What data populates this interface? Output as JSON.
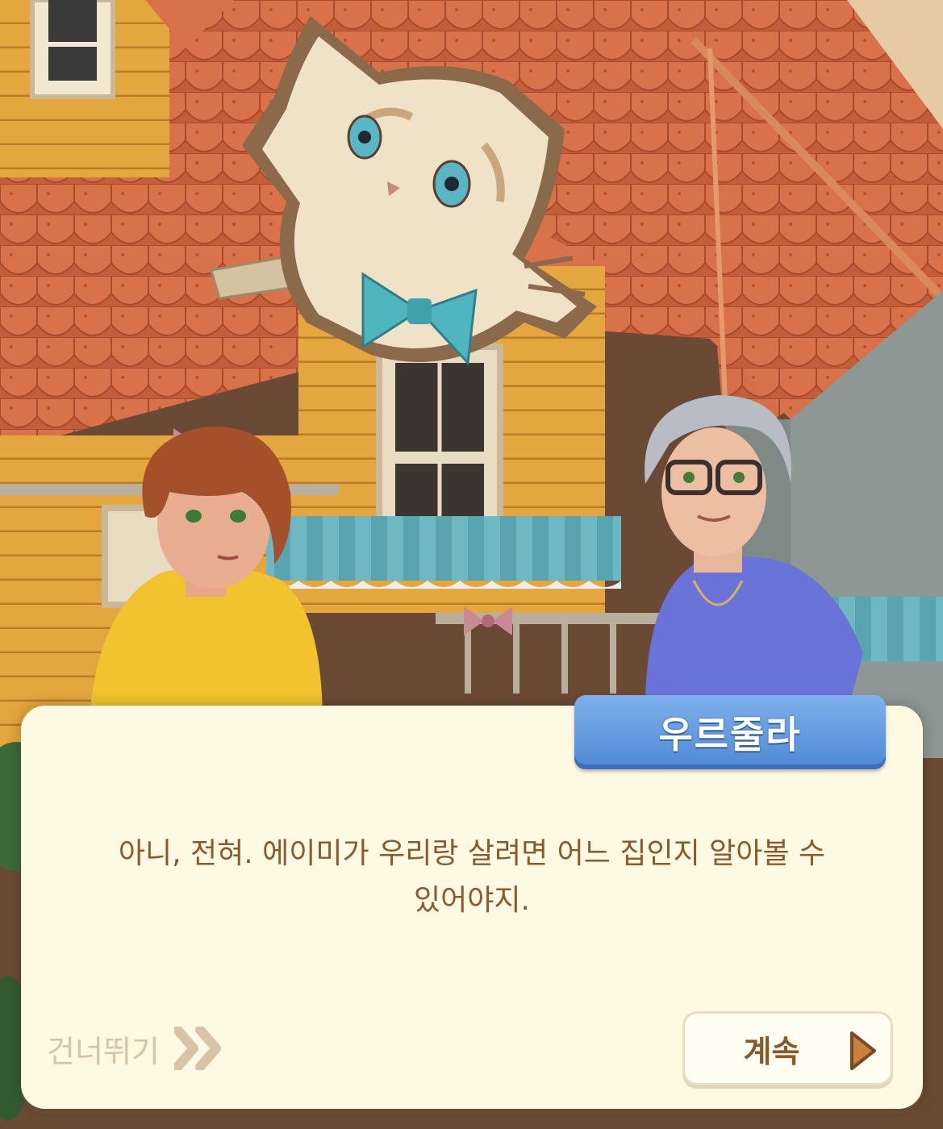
{
  "dialog": {
    "speaker_name": "우르줄라",
    "line1": "아니, 전혀. 에이미가 우리랑 살려면 어느 집인지 알아볼 수",
    "line2": "있어야지."
  },
  "controls": {
    "skip_label": "건너뛰기",
    "continue_label": "계속"
  },
  "colors": {
    "roof": "#c8623e",
    "wall": "#e0a23c",
    "nameplate": "#5a92dc",
    "dialog_bg": "#fdf9e3",
    "dialog_text": "#8a5a2b"
  }
}
